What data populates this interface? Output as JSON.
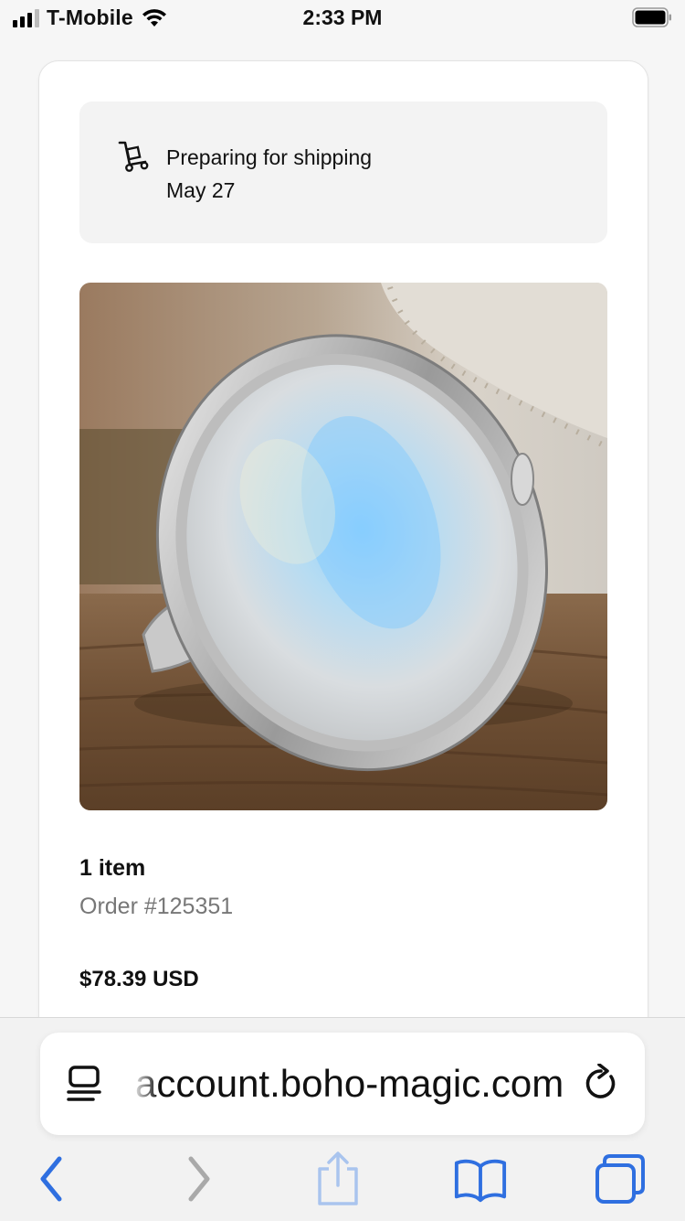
{
  "status_bar": {
    "carrier": "T-Mobile",
    "time": "2:33 PM",
    "icons": [
      "signal-icon",
      "wifi-icon",
      "battery-icon"
    ]
  },
  "order": {
    "shipping_status": "Preparing for shipping",
    "shipping_date": "May 27",
    "item_count": "1 item",
    "order_number": "Order #125351",
    "total": "$78.39 USD"
  },
  "browser": {
    "url": "account.boho-magic.com",
    "icons": [
      "reader-view-icon",
      "reload-icon",
      "back-icon",
      "forward-icon",
      "share-icon",
      "bookmarks-icon",
      "tabs-icon"
    ]
  },
  "colors": {
    "accent": "#2f6fe0",
    "disabled": "#a9a9a9",
    "share_disabled": "#a9c4ee"
  }
}
